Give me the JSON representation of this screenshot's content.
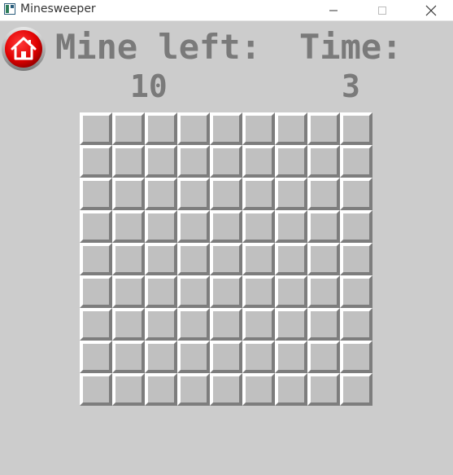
{
  "window": {
    "title": "Minesweeper"
  },
  "hud": {
    "mines_label": "Mine left:",
    "mines_value": "10",
    "time_label": "Time:",
    "time_value": "3"
  },
  "board": {
    "rows": 9,
    "cols": 9,
    "state": "all-covered"
  },
  "icons": {
    "app": "minesweeper-app-icon",
    "home": "home-icon"
  },
  "colors": {
    "background": "#cccccc",
    "home_button": "#e00000",
    "hud_text": "#7a7a7a",
    "cell_face": "#c0c0c0"
  }
}
